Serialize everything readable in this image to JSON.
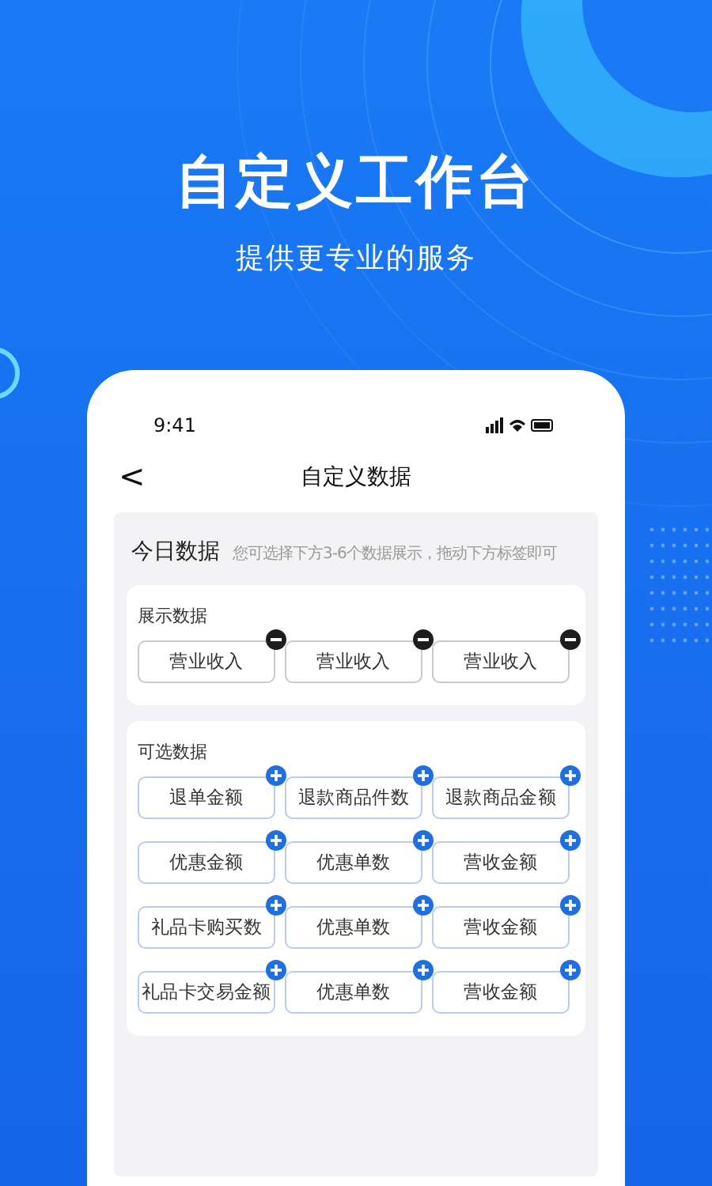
{
  "headline": "自定义工作台",
  "subline": "提供更专业的服务",
  "status_bar": {
    "time": "9:41"
  },
  "nav": {
    "back": "<",
    "title": "自定义数据"
  },
  "panel": {
    "title": "今日数据",
    "hint": "您可选择下方3-6个数据展示，拖动下方标签即可"
  },
  "sections": [
    {
      "title": "展示数据",
      "kind": "remove",
      "items": [
        "营业收入",
        "营业收入",
        "营业收入"
      ]
    },
    {
      "title": "可选数据",
      "kind": "add",
      "items": [
        "退单金额",
        "退款商品件数",
        "退款商品金额",
        "优惠金额",
        "优惠单数",
        "营收金额",
        "礼品卡购买数",
        "优惠单数",
        "营收金额",
        "礼品卡交易金额",
        "优惠单数",
        "营收金额"
      ]
    }
  ]
}
